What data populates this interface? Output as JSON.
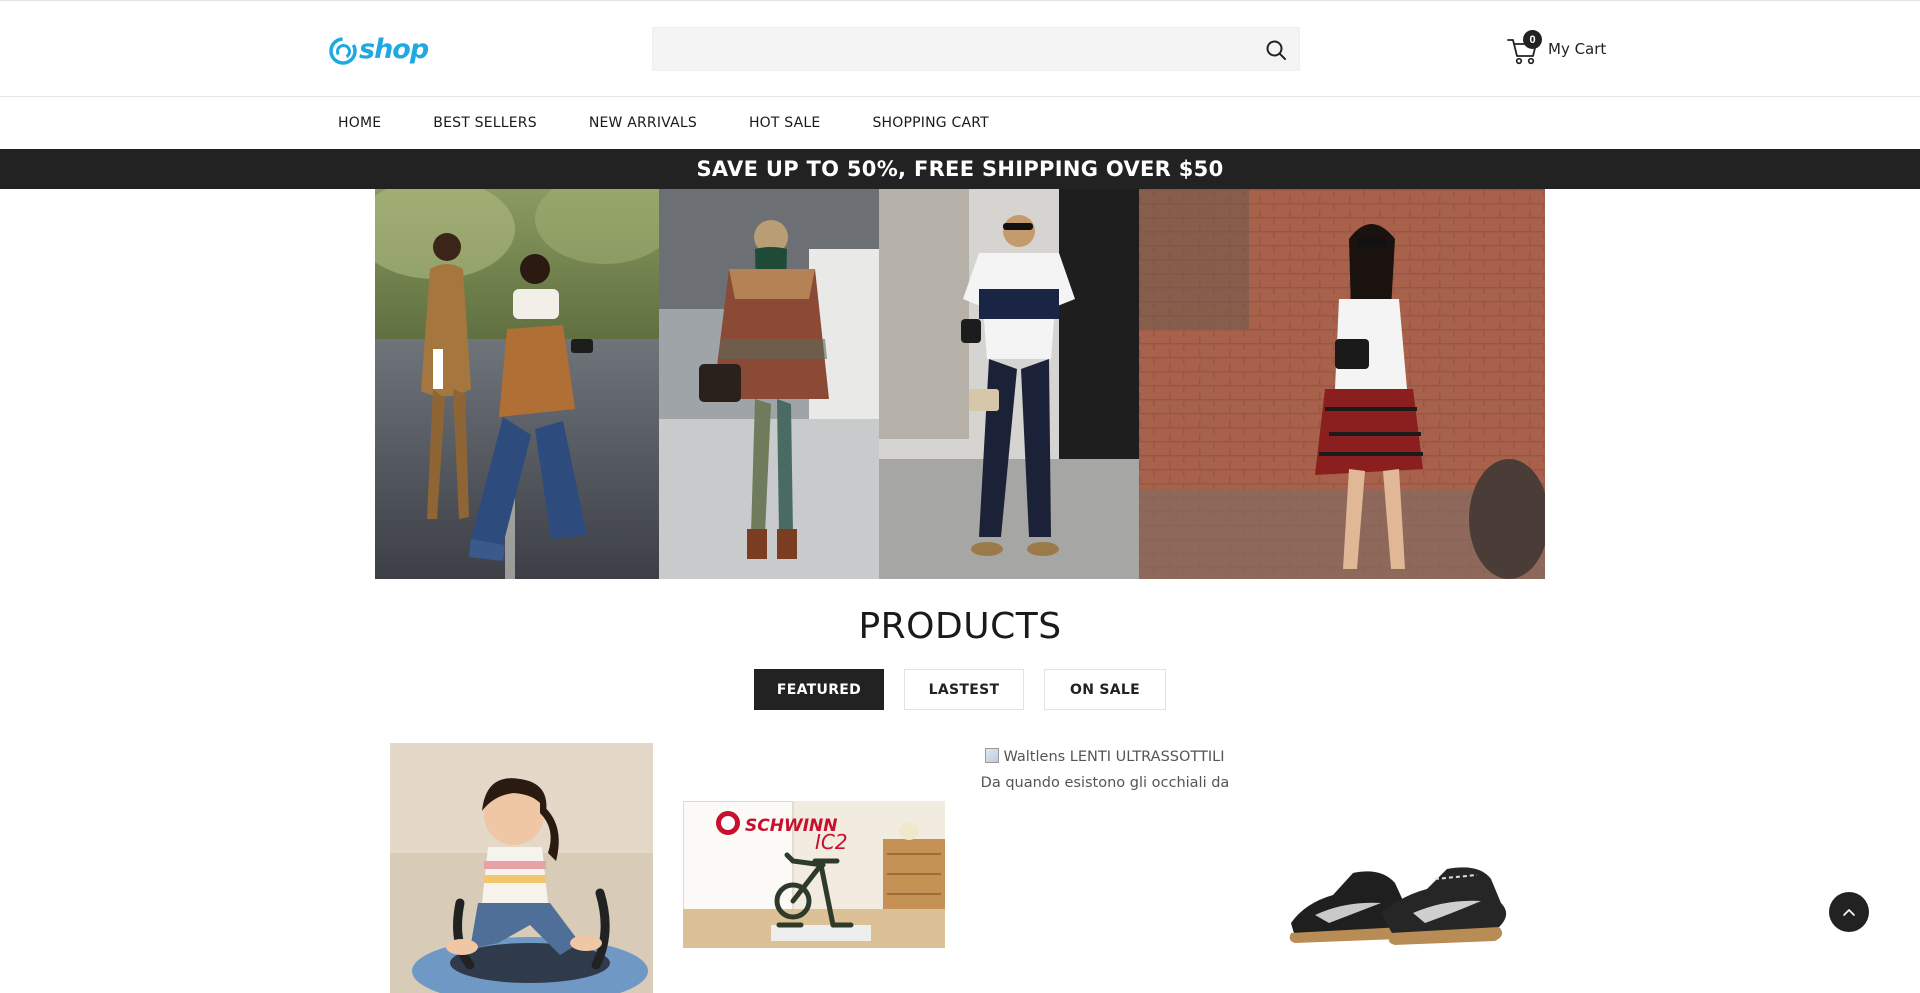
{
  "header": {
    "logo_text": "shop",
    "search": {
      "value": "",
      "placeholder": ""
    },
    "cart": {
      "count": "0",
      "label": "My Cart"
    }
  },
  "nav": {
    "items": [
      {
        "label": "HOME"
      },
      {
        "label": "BEST SELLERS"
      },
      {
        "label": "NEW ARRIVALS"
      },
      {
        "label": "HOT SALE"
      },
      {
        "label": "SHOPPING CART"
      }
    ]
  },
  "promo": {
    "text": "SAVE UP TO 50%, FREE SHIPPING OVER $50"
  },
  "products": {
    "title": "PRODUCTS",
    "tabs": [
      {
        "label": "FEATURED",
        "active": true
      },
      {
        "label": "LASTEST",
        "active": false
      },
      {
        "label": "ON SALE",
        "active": false
      }
    ],
    "items": [
      {
        "image_alt": ""
      },
      {
        "image_alt": "",
        "brand_text": "SCHWINN",
        "model_text": "IC2"
      },
      {
        "image_alt": "Waltlens LENTI ULTRASSOTTILI Da quando esistono gli occhiali da"
      },
      {
        "image_alt": ""
      }
    ]
  },
  "colors": {
    "brand": "#1ea9e1",
    "dark": "#222222",
    "promo_bg": "#222222",
    "search_bg": "#f4f4f4"
  },
  "icons": {
    "search": "search-icon",
    "cart": "cart-icon",
    "back_to_top": "chevron-up-icon",
    "logo": "logo-swirl-icon"
  }
}
